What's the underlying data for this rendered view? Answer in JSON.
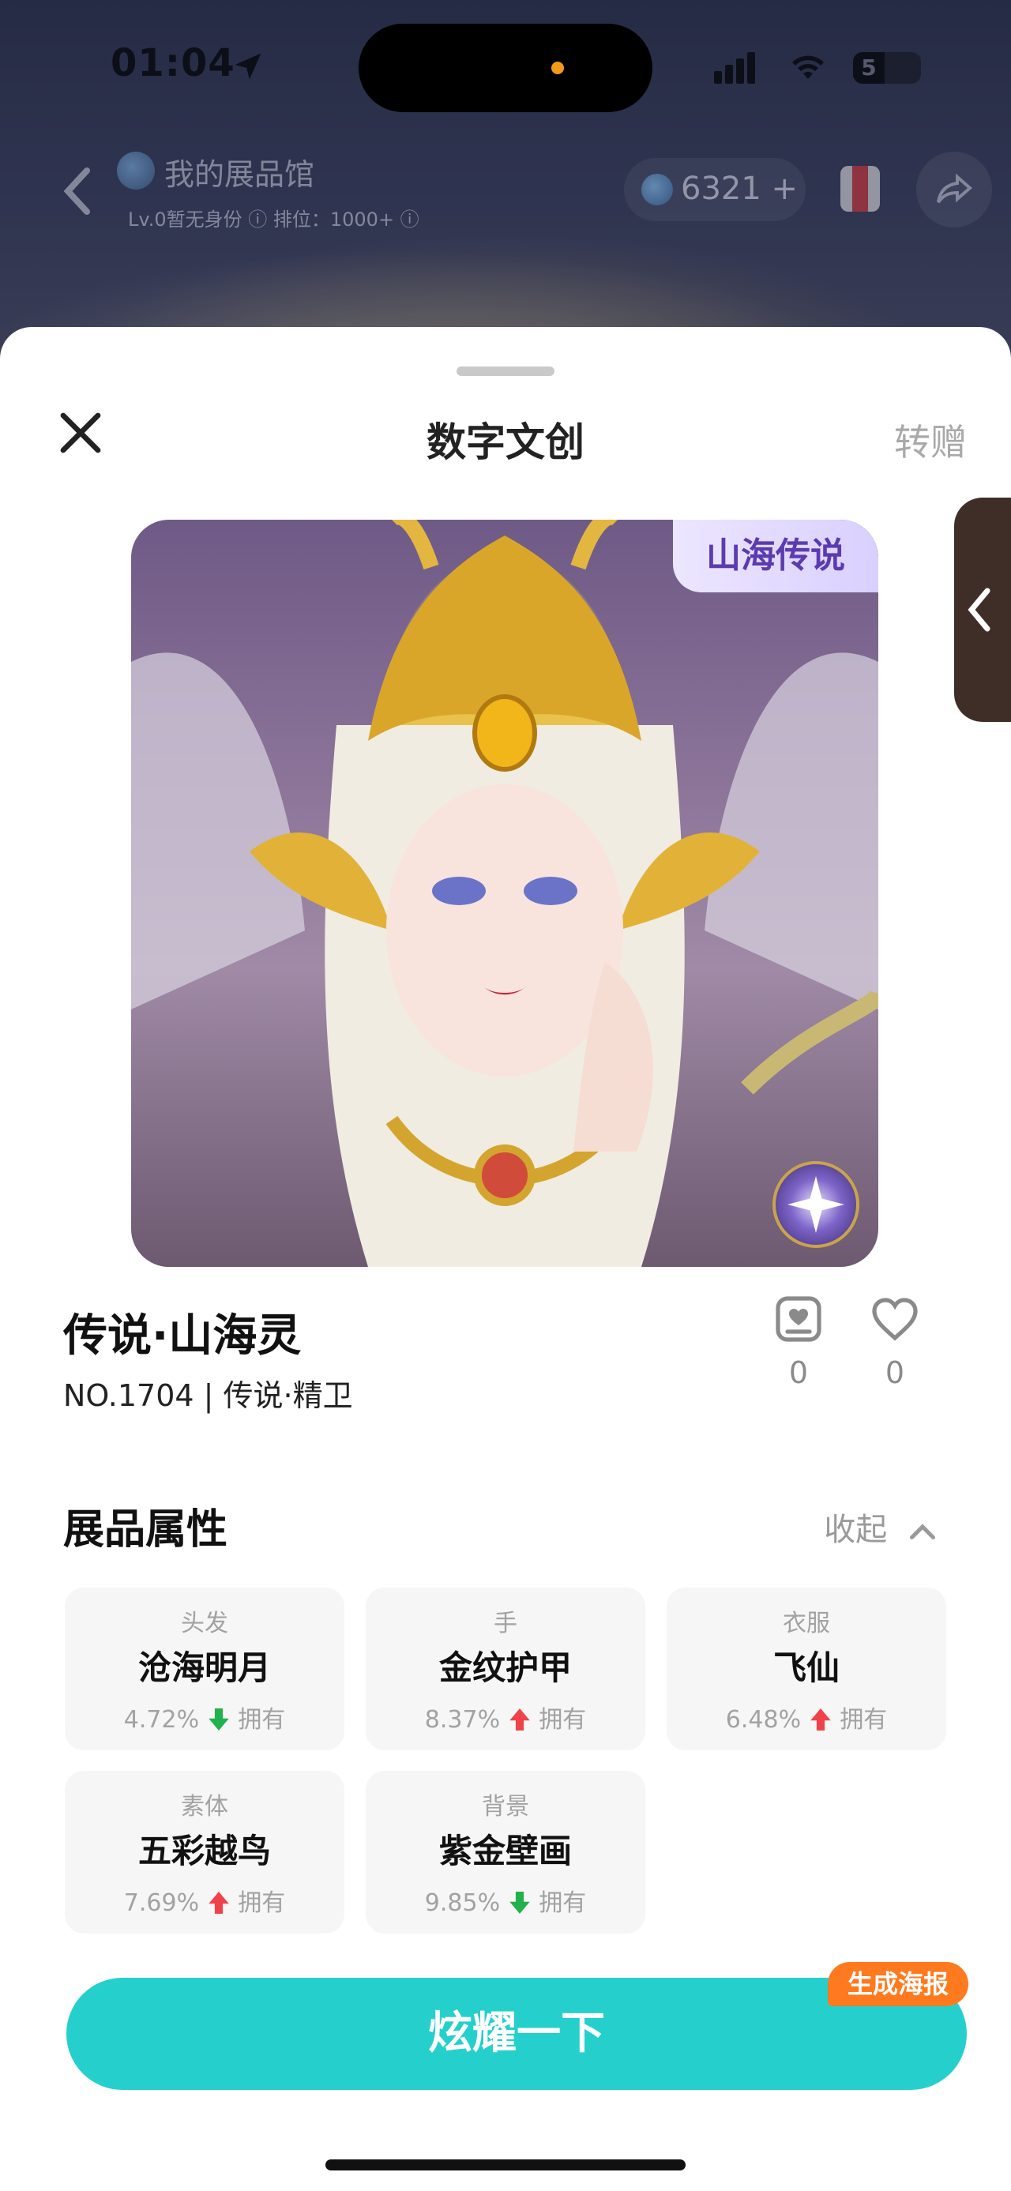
{
  "status_bar": {
    "time": "01:04",
    "battery": "5"
  },
  "background_page": {
    "title": "我的展品馆",
    "subtitle": "Lv.0暂无身份 ⓘ   排位：1000+ ⓘ",
    "points": "6321 +"
  },
  "sheet": {
    "title": "数字文创",
    "gift_label": "转赠",
    "artwork_badge": "山海传说",
    "item": {
      "name": "传说·山海灵",
      "number_series": "NO.1704 | 传说·精卫",
      "collect_count": "0",
      "like_count": "0"
    },
    "attributes_heading": "展品属性",
    "collapse_label": "收起",
    "attributes": [
      {
        "category": "头发",
        "value": "沧海明月",
        "percent": "4.72%",
        "trend": "down",
        "owned": "拥有"
      },
      {
        "category": "手",
        "value": "金纹护甲",
        "percent": "8.37%",
        "trend": "up",
        "owned": "拥有"
      },
      {
        "category": "衣服",
        "value": "飞仙",
        "percent": "6.48%",
        "trend": "up",
        "owned": "拥有"
      },
      {
        "category": "素体",
        "value": "五彩越鸟",
        "percent": "7.69%",
        "trend": "up",
        "owned": "拥有"
      },
      {
        "category": "背景",
        "value": "紫金壁画",
        "percent": "9.85%",
        "trend": "down",
        "owned": "拥有"
      }
    ],
    "show_button_label": "炫耀一下",
    "poster_badge": "生成海报"
  },
  "colors": {
    "accent_teal": "#25d0cc",
    "badge_orange": "#ff7a1e",
    "trend_up": "#f0424b",
    "trend_down": "#22b14c"
  },
  "icons": {
    "close": "close-icon",
    "collect": "collection-card-icon",
    "like": "heart-icon",
    "collapse": "chevron-up-icon",
    "trend_up": "arrow-up-icon",
    "trend_down": "arrow-down-icon",
    "side_tab": "chevron-left-icon",
    "share": "share-icon"
  }
}
